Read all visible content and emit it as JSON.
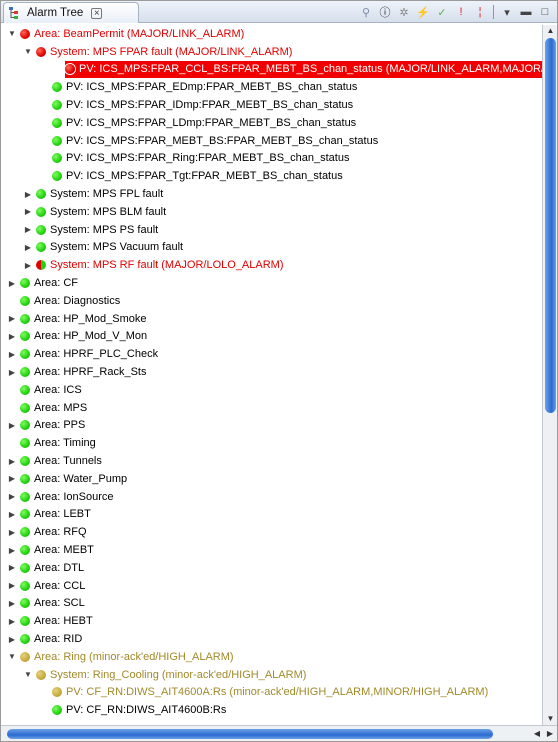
{
  "tab": {
    "title": "Alarm Tree",
    "close_symbol": "⊠"
  },
  "toolbar": [
    {
      "icon": "search-pv-icon",
      "glyph": "⚲",
      "color": "#7a8aa6"
    },
    {
      "icon": "info-icon",
      "glyph": "ⓘ",
      "color": "#1a1a1a"
    },
    {
      "icon": "maintenance-mode-icon",
      "glyph": "✲",
      "color": "#8a8a8a"
    },
    {
      "icon": "unacknowledge-icon",
      "glyph": "⚡",
      "color": "#9aa3b0"
    },
    {
      "icon": "acknowledge-icon",
      "glyph": "✓",
      "color": "#58b84a"
    },
    {
      "icon": "show-alarms-only-icon",
      "glyph": "!",
      "color": "#e02020"
    },
    {
      "icon": "filter-icon",
      "glyph": "¦",
      "color": "#e02020"
    },
    {
      "icon": "view-menu-icon",
      "glyph": "▾",
      "color": "#444"
    },
    {
      "icon": "minimize-icon",
      "glyph": "▬",
      "color": "#444"
    },
    {
      "icon": "maximize-icon",
      "glyph": "□",
      "color": "#444"
    }
  ],
  "tree": [
    {
      "level": 0,
      "twisty": "open",
      "dot": "red",
      "label": "Area: BeamPermit (MAJOR/LINK_ALARM)",
      "color": "red"
    },
    {
      "level": 1,
      "twisty": "open",
      "dot": "red",
      "label": "System: MPS FPAR fault (MAJOR/LINK_ALARM)",
      "color": "red"
    },
    {
      "level": 2,
      "twisty": "none",
      "dot": "red",
      "label": "PV: ICS_MPS:FPAR_CCL_BS:FPAR_MEBT_BS_chan_status (MAJOR/LINK_ALARM,MAJOR/",
      "color": "white",
      "selected": true
    },
    {
      "level": 2,
      "twisty": "none",
      "dot": "green",
      "label": "PV: ICS_MPS:FPAR_EDmp:FPAR_MEBT_BS_chan_status",
      "color": "black"
    },
    {
      "level": 2,
      "twisty": "none",
      "dot": "green",
      "label": "PV: ICS_MPS:FPAR_IDmp:FPAR_MEBT_BS_chan_status",
      "color": "black"
    },
    {
      "level": 2,
      "twisty": "none",
      "dot": "green",
      "label": "PV: ICS_MPS:FPAR_LDmp:FPAR_MEBT_BS_chan_status",
      "color": "black"
    },
    {
      "level": 2,
      "twisty": "none",
      "dot": "green",
      "label": "PV: ICS_MPS:FPAR_MEBT_BS:FPAR_MEBT_BS_chan_status",
      "color": "black"
    },
    {
      "level": 2,
      "twisty": "none",
      "dot": "green",
      "label": "PV: ICS_MPS:FPAR_Ring:FPAR_MEBT_BS_chan_status",
      "color": "black"
    },
    {
      "level": 2,
      "twisty": "none",
      "dot": "green",
      "label": "PV: ICS_MPS:FPAR_Tgt:FPAR_MEBT_BS_chan_status",
      "color": "black"
    },
    {
      "level": 1,
      "twisty": "closed",
      "dot": "green",
      "label": "System: MPS FPL fault",
      "color": "black"
    },
    {
      "level": 1,
      "twisty": "closed",
      "dot": "green",
      "label": "System: MPS BLM fault",
      "color": "black"
    },
    {
      "level": 1,
      "twisty": "closed",
      "dot": "green",
      "label": "System: MPS PS fault",
      "color": "black"
    },
    {
      "level": 1,
      "twisty": "closed",
      "dot": "green",
      "label": "System: MPS Vacuum fault",
      "color": "black"
    },
    {
      "level": 1,
      "twisty": "closed",
      "dot": "half",
      "label": "System: MPS RF fault (MAJOR/LOLO_ALARM)",
      "color": "red"
    },
    {
      "level": 0,
      "twisty": "closed",
      "dot": "green",
      "label": "Area: CF",
      "color": "black"
    },
    {
      "level": 0,
      "twisty": "none",
      "dot": "green",
      "label": "Area: Diagnostics",
      "color": "black"
    },
    {
      "level": 0,
      "twisty": "closed",
      "dot": "green",
      "label": "Area: HP_Mod_Smoke",
      "color": "black"
    },
    {
      "level": 0,
      "twisty": "closed",
      "dot": "green",
      "label": "Area: HP_Mod_V_Mon",
      "color": "black"
    },
    {
      "level": 0,
      "twisty": "closed",
      "dot": "green",
      "label": "Area: HPRF_PLC_Check",
      "color": "black"
    },
    {
      "level": 0,
      "twisty": "closed",
      "dot": "green",
      "label": "Area: HPRF_Rack_Sts",
      "color": "black"
    },
    {
      "level": 0,
      "twisty": "none",
      "dot": "green",
      "label": "Area: ICS",
      "color": "black"
    },
    {
      "level": 0,
      "twisty": "none",
      "dot": "green",
      "label": "Area: MPS",
      "color": "black"
    },
    {
      "level": 0,
      "twisty": "closed",
      "dot": "green",
      "label": "Area: PPS",
      "color": "black"
    },
    {
      "level": 0,
      "twisty": "none",
      "dot": "green",
      "label": "Area: Timing",
      "color": "black"
    },
    {
      "level": 0,
      "twisty": "closed",
      "dot": "green",
      "label": "Area: Tunnels",
      "color": "black"
    },
    {
      "level": 0,
      "twisty": "closed",
      "dot": "green",
      "label": "Area: Water_Pump",
      "color": "black"
    },
    {
      "level": 0,
      "twisty": "closed",
      "dot": "green",
      "label": "Area: IonSource",
      "color": "black"
    },
    {
      "level": 0,
      "twisty": "closed",
      "dot": "green",
      "label": "Area: LEBT",
      "color": "black"
    },
    {
      "level": 0,
      "twisty": "closed",
      "dot": "green",
      "label": "Area: RFQ",
      "color": "black"
    },
    {
      "level": 0,
      "twisty": "closed",
      "dot": "green",
      "label": "Area: MEBT",
      "color": "black"
    },
    {
      "level": 0,
      "twisty": "closed",
      "dot": "green",
      "label": "Area: DTL",
      "color": "black"
    },
    {
      "level": 0,
      "twisty": "closed",
      "dot": "green",
      "label": "Area: CCL",
      "color": "black"
    },
    {
      "level": 0,
      "twisty": "closed",
      "dot": "green",
      "label": "Area: SCL",
      "color": "black"
    },
    {
      "level": 0,
      "twisty": "closed",
      "dot": "green",
      "label": "Area: HEBT",
      "color": "black"
    },
    {
      "level": 0,
      "twisty": "closed",
      "dot": "green",
      "label": "Area: RID",
      "color": "black"
    },
    {
      "level": 0,
      "twisty": "open",
      "dot": "olive",
      "label": "Area: Ring (minor-ack'ed/HIGH_ALARM)",
      "color": "olive"
    },
    {
      "level": 1,
      "twisty": "open",
      "dot": "olive",
      "label": "System: Ring_Cooling (minor-ack'ed/HIGH_ALARM)",
      "color": "olive"
    },
    {
      "level": 2,
      "twisty": "none",
      "dot": "olive",
      "label": "PV: CF_RN:DIWS_AIT4600A:Rs (minor-ack'ed/HIGH_ALARM,MINOR/HIGH_ALARM)",
      "color": "olive"
    },
    {
      "level": 2,
      "twisty": "none",
      "dot": "green",
      "label": "PV: CF_RN:DIWS_AIT4600B:Rs",
      "color": "black"
    }
  ]
}
